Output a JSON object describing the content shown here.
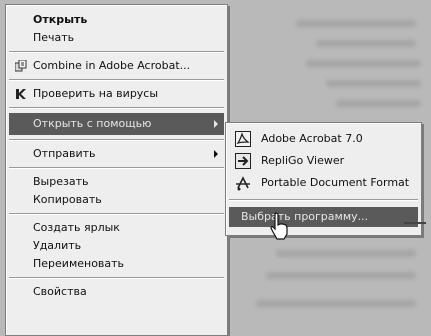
{
  "main_menu": {
    "items": [
      {
        "label": "Открыть"
      },
      {
        "label": "Печать"
      },
      {
        "label": "Combine in Adobe Acrobat...",
        "icon": "acrobat-combine-icon"
      },
      {
        "label": "Проверить на вирусы",
        "icon": "antivirus-icon"
      },
      {
        "label": "Открыть с помощью",
        "has_submenu": true
      },
      {
        "label": "Отправить",
        "has_submenu": true
      },
      {
        "label": "Вырезать"
      },
      {
        "label": "Копировать"
      },
      {
        "label": "Создать ярлык"
      },
      {
        "label": "Удалить"
      },
      {
        "label": "Переименовать"
      },
      {
        "label": "Свойства"
      }
    ]
  },
  "open_with_submenu": {
    "items": [
      {
        "label": "Adobe Acrobat 7.0",
        "icon": "adobe-acrobat-icon"
      },
      {
        "label": "RepliGo Viewer",
        "icon": "repligo-icon"
      },
      {
        "label": "Portable Document Format",
        "icon": "pdf-format-icon"
      },
      {
        "label": "Выбрать программу..."
      }
    ]
  },
  "colors": {
    "menu_bg": "#eeeeee",
    "highlight_bg": "#5a5a5a",
    "highlight_text": "#e6e6e6",
    "page_bg": "#b9b9b9"
  }
}
